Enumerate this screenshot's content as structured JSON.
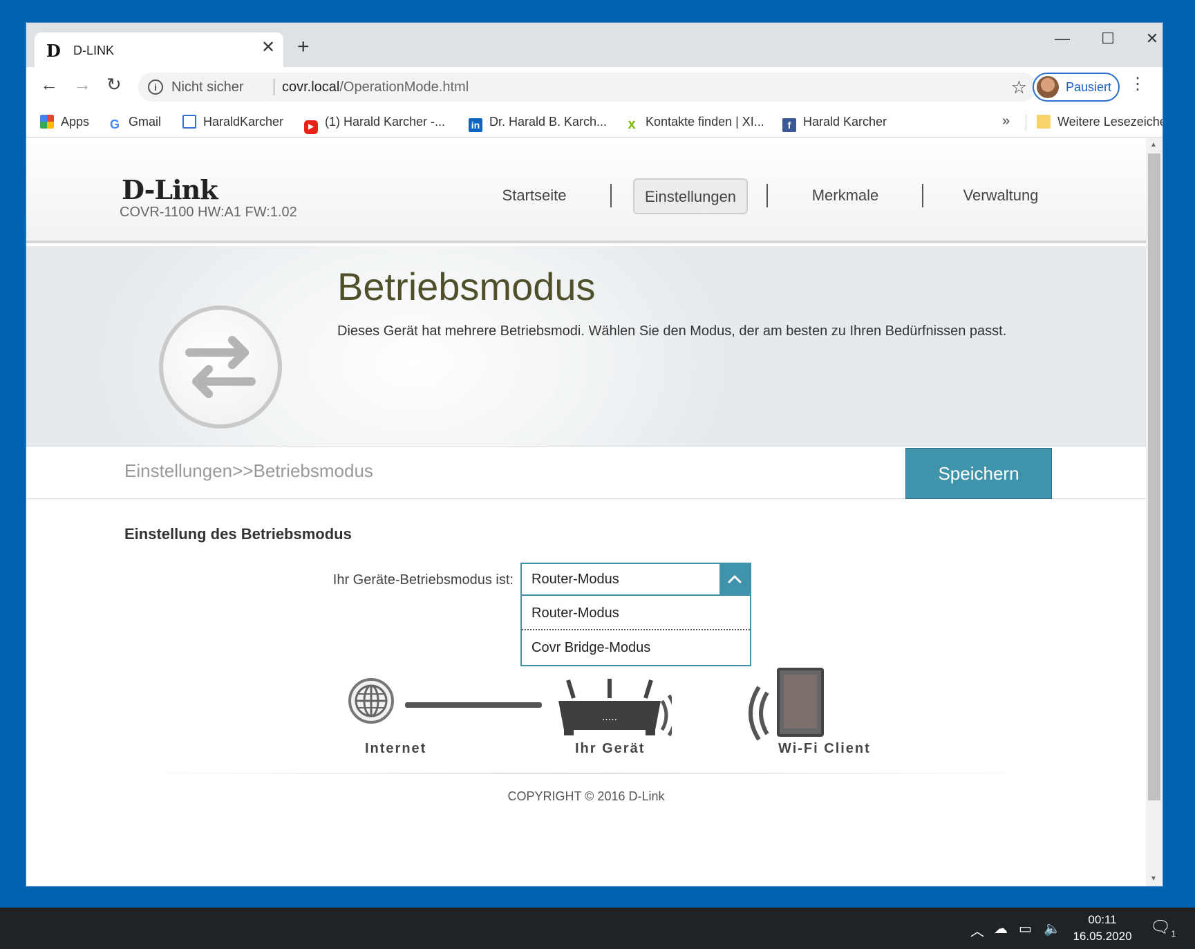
{
  "browser": {
    "tab_title": "D-LINK",
    "tab_favicon": "D",
    "not_secure": "Nicht sicher",
    "url_host": "covr.local",
    "url_path": "/OperationMode.html",
    "profile_label": "Pausiert",
    "bookmarks": [
      {
        "label": "Apps",
        "icon": "apps-grid-icon"
      },
      {
        "label": "Gmail",
        "icon": "google-icon"
      },
      {
        "label": "HaraldKarcher",
        "icon": "calendar-icon"
      },
      {
        "label": "(1) Harald Karcher -...",
        "icon": "youtube-icon"
      },
      {
        "label": "Dr. Harald B. Karch...",
        "icon": "linkedin-icon"
      },
      {
        "label": "Kontakte finden | XI...",
        "icon": "xing-icon"
      },
      {
        "label": "Harald Karcher",
        "icon": "facebook-icon"
      },
      {
        "label": "Weitere Lesezeichen",
        "icon": "folder-icon"
      }
    ]
  },
  "page": {
    "logo": "D-Link",
    "model": "COVR-1100 HW:A1 FW:1.02",
    "nav": [
      "Startseite",
      "Einstellungen",
      "Merkmale",
      "Verwaltung"
    ],
    "active_nav": "Einstellungen",
    "title": "Betriebsmodus",
    "description": "Dieses Gerät hat mehrere Betriebsmodi. Wählen Sie den Modus, der am besten zu Ihren Bedürfnissen passt.",
    "breadcrumb": "Einstellungen>>Betriebsmodus",
    "save_label": "Speichern",
    "section_title": "Einstellung des Betriebsmodus",
    "mode_label": "Ihr Geräte-Betriebsmodus ist:",
    "mode_selected": "Router-Modus",
    "mode_options": [
      "Router-Modus",
      "Covr Bridge-Modus"
    ],
    "diagram_labels": {
      "internet": "Internet",
      "device": "Ihr Gerät",
      "client": "Wi-Fi Client"
    },
    "copyright": "COPYRIGHT © 2016 D-Link"
  },
  "taskbar": {
    "time": "00:11",
    "date": "16.05.2020",
    "notification_count": "1"
  },
  "colors": {
    "accent": "#3f94ab",
    "desktop": "#0063b1",
    "title_text": "#4f4f2a"
  }
}
